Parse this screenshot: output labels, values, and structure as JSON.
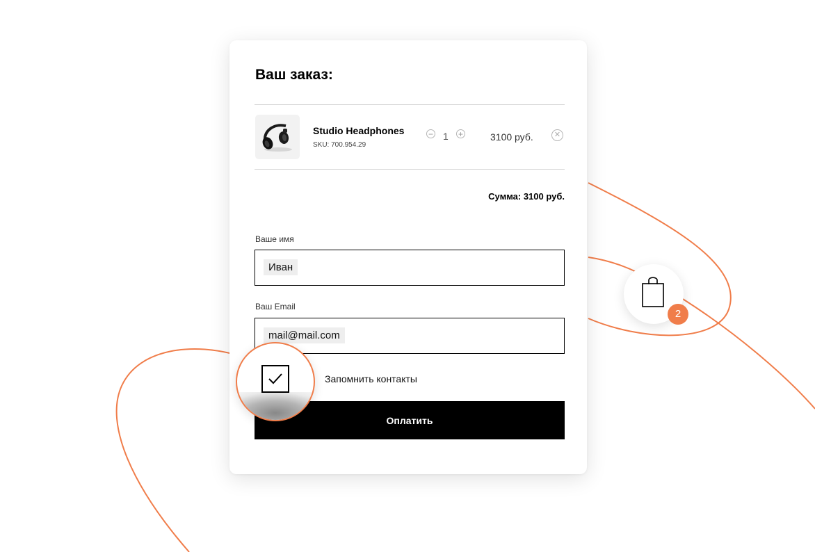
{
  "order": {
    "title": "Ваш заказ:",
    "items": [
      {
        "name": "Studio Headphones",
        "sku": "SKU: 700.954.29",
        "quantity": "1",
        "price": "3100 руб.",
        "minus_icon": "minus-circle-icon",
        "plus_icon": "plus-circle-icon",
        "remove_icon": "close-circle-icon"
      }
    ],
    "total": "Сумма: 3100 руб."
  },
  "form": {
    "name_label": "Ваше имя",
    "name_value": "Иван",
    "email_label": "Ваш Email",
    "email_value": "mail@mail.com",
    "remember_label": "Запомнить контакты",
    "remember_checked": true,
    "submit_label": "Оплатить"
  },
  "cart": {
    "icon": "shopping-bag-icon",
    "count": "2"
  },
  "colors": {
    "accent": "#f07d4a",
    "button": "#000000",
    "text": "#000000"
  }
}
